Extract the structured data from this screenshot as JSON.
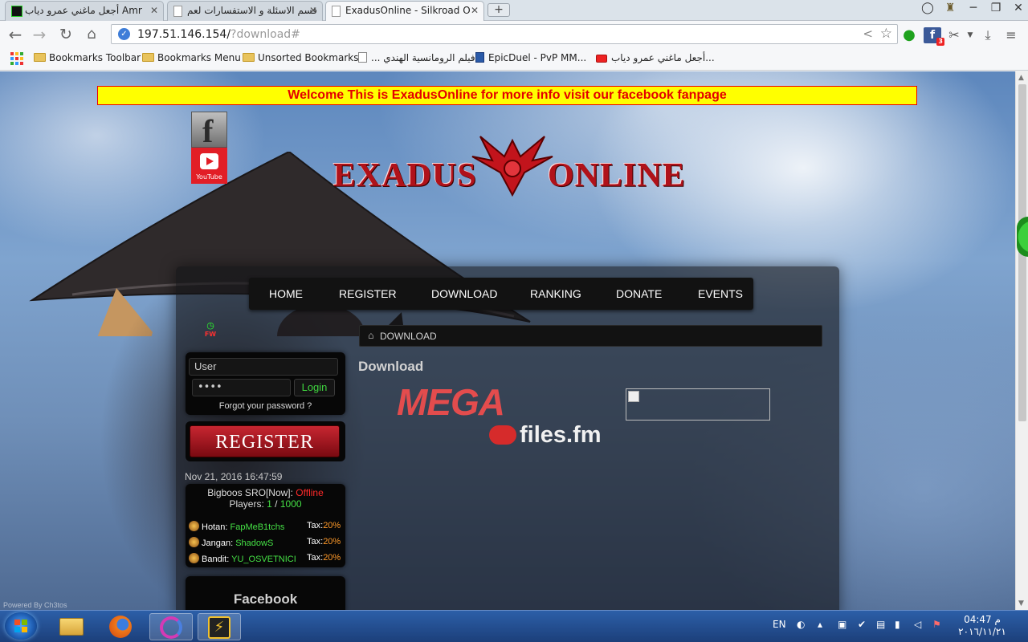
{
  "browser": {
    "tabs": [
      {
        "label": "أجعل ماغني عمرو دياب Amr"
      },
      {
        "label": "قسم الاسئلة و الاستفسارات لعم"
      },
      {
        "label": "ExadusOnline - Silkroad O"
      }
    ],
    "url": {
      "host": "197.51.146.154/",
      "path": "?download#"
    },
    "bookmarks": [
      {
        "label": "Bookmarks Toolbar",
        "kind": "folder"
      },
      {
        "label": "Bookmarks Menu",
        "kind": "folder"
      },
      {
        "label": "Unsorted Bookmarks",
        "kind": "folder"
      },
      {
        "label": "... فيلم الرومانسية الهندي",
        "kind": "page"
      },
      {
        "label": "EpicDuel - PvP MM...",
        "kind": "page"
      },
      {
        "label": "أجعل ماغني عمرو دياب...",
        "kind": "youtube"
      }
    ],
    "extension_badge": "3"
  },
  "page": {
    "welcome": "Welcome This is ExadusOnline for more info visit our facebook fanpage",
    "social": {
      "facebook_letter": "f",
      "youtube_label": "YouTube"
    },
    "logo": {
      "left": "EXADUS",
      "right": "ONLINE"
    },
    "nav": [
      "HOME",
      "REGISTER",
      "DOWNLOAD",
      "RANKING",
      "DONATE",
      "EVENTS"
    ],
    "fw_label": "FW",
    "login": {
      "user_placeholder": "User",
      "password_mask": "••••",
      "login_button": "Login",
      "forgot": "Forgot your password ?"
    },
    "register_banner": "REGISTER",
    "server": {
      "datetime": "Nov 21, 2016 16:47:59",
      "name": "Bigboos SRO[Now]: ",
      "status": "Offline",
      "players_label": "Players: ",
      "players_online": "1",
      "players_sep": " / ",
      "players_max": "1000",
      "guilds": [
        {
          "town": "Hotan",
          "owner": "FapMeB1tchs",
          "tax_label": "Tax:",
          "tax": "20%"
        },
        {
          "town": "Jangan",
          "owner": "ShadowS",
          "tax_label": "Tax:",
          "tax": "20%"
        },
        {
          "town": "Bandit",
          "owner": "YU_OSVETNICI",
          "tax_label": "Tax:",
          "tax": "20%"
        }
      ]
    },
    "facebook_panel_title": "Facebook",
    "breadcrumb": "DOWNLOAD",
    "content_title": "Download",
    "mirrors": {
      "mega": "MEGA",
      "filesfm": "files.fm"
    },
    "powered_by": "Powered By Ch3tos"
  },
  "taskbar": {
    "lang": "EN",
    "time": "04:47 م",
    "date": "٢٠١٦/١١/٢١"
  },
  "colors": {
    "welcome_bg": "#ffff00",
    "welcome_text": "#e40000",
    "accent_red": "#b0121a",
    "online_green": "#45e045",
    "offline_red": "#ff2a2a",
    "tax_orange": "#ff9a2a"
  }
}
